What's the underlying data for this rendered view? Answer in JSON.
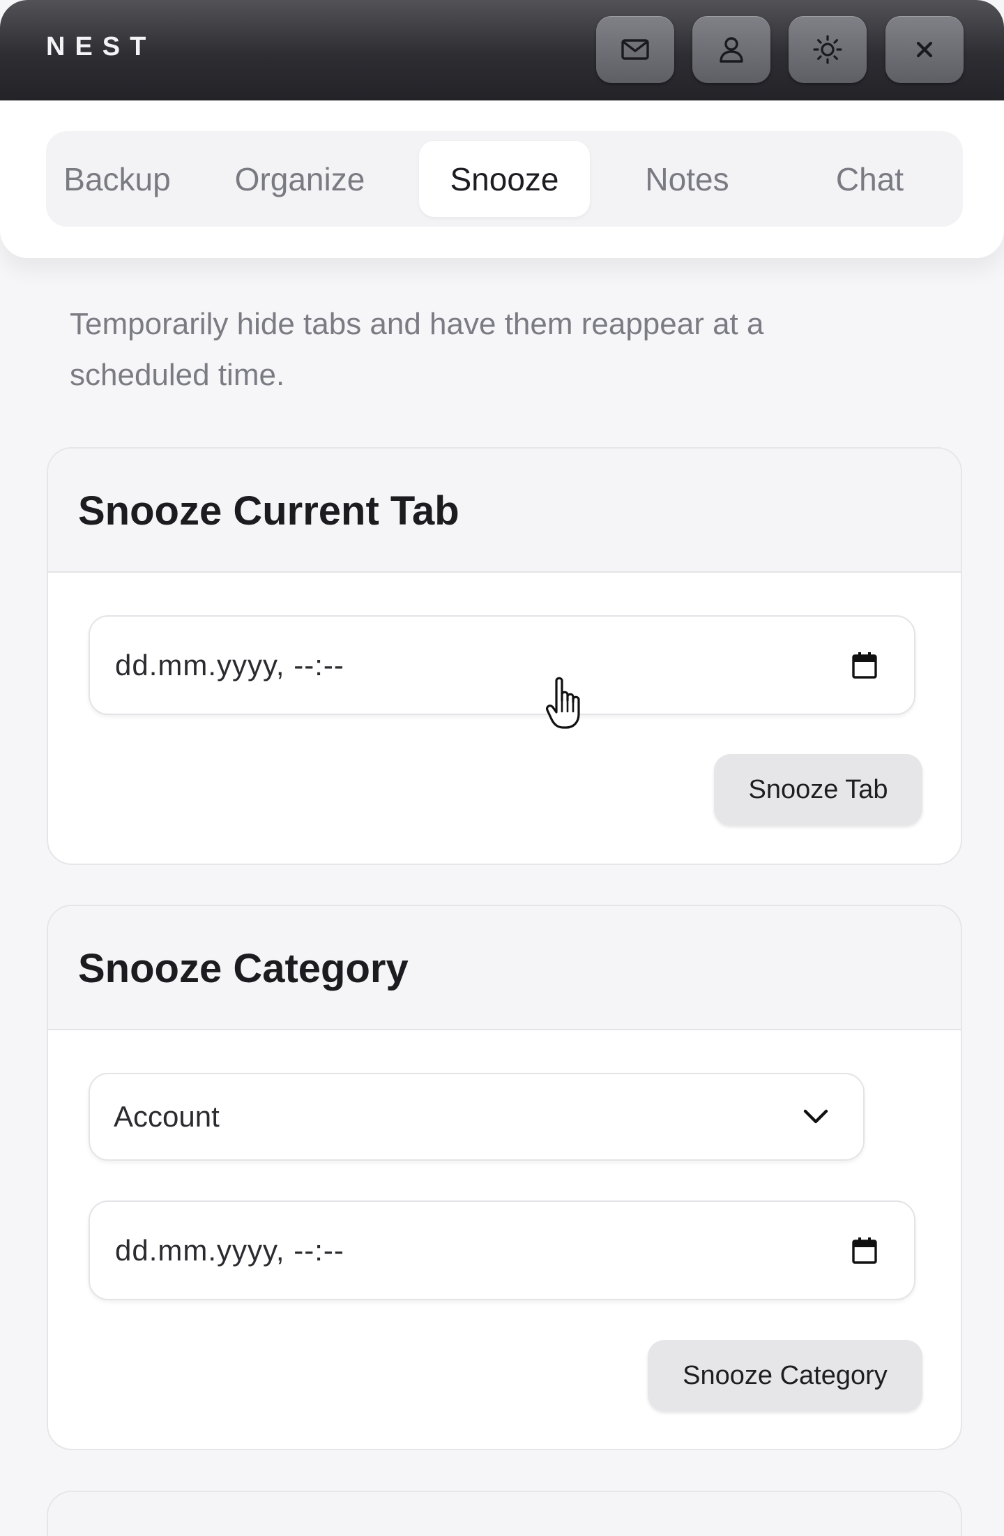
{
  "header": {
    "brand": "NEST",
    "icons": [
      "mail-icon",
      "user-icon",
      "sun-icon",
      "close-icon"
    ]
  },
  "tabs": [
    {
      "label": "Backup",
      "active": false
    },
    {
      "label": "Organize",
      "active": false
    },
    {
      "label": "Snooze",
      "active": true
    },
    {
      "label": "Notes",
      "active": false
    },
    {
      "label": "Chat",
      "active": false
    }
  ],
  "description": "Temporarily hide tabs and have them reappear at a scheduled time.",
  "snooze_tab_card": {
    "title": "Snooze Current Tab",
    "datetime_placeholder": "dd.mm.yyyy, --:--",
    "button_label": "Snooze Tab"
  },
  "snooze_category_card": {
    "title": "Snooze Category",
    "category_selected": "Account",
    "datetime_placeholder": "dd.mm.yyyy, --:--",
    "button_label": "Snooze Category"
  },
  "colors": {
    "header_dark": "#2d2d32",
    "background": "#f6f6f8",
    "tab_inactive_text": "#7a7a82",
    "button_bg": "#e6e6e9"
  }
}
